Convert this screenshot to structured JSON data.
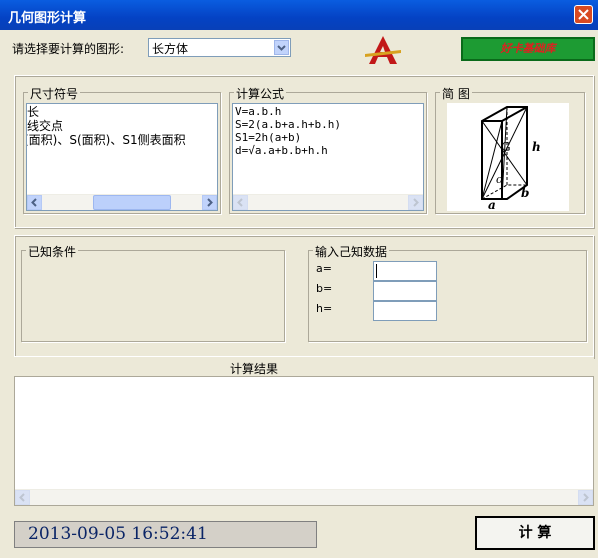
{
  "window": {
    "title": "几何图形计算"
  },
  "shape_select": {
    "label": "请选择要计算的图形:",
    "value": "长方体"
  },
  "green_button": {
    "label": "好卡基础库"
  },
  "dimensions": {
    "legend": "尺寸符号",
    "lines": [
      "长",
      "线交点",
      "(面积)、S(面积)、S1侧表面积"
    ]
  },
  "formulas": {
    "legend": "计算公式",
    "lines": [
      "V=a.b.h",
      "S=2(a.b+a.h+b.h)",
      "S1=2h(a+b)",
      "d=√a.a+b.b+h.h"
    ]
  },
  "diagram": {
    "legend": "简   图",
    "labels": {
      "h": "h",
      "a": "a",
      "b": "b",
      "G": "G",
      "o": "o"
    }
  },
  "known_conditions": {
    "legend": "已知条件"
  },
  "input_data": {
    "legend": "输入己知数据",
    "fields": [
      {
        "label": "a=",
        "value": ""
      },
      {
        "label": "b=",
        "value": ""
      },
      {
        "label": "h=",
        "value": ""
      }
    ]
  },
  "result": {
    "header": "计算结果",
    "value": ""
  },
  "status": {
    "datetime": "2013-09-05  16:52:41"
  },
  "calc_button": {
    "label": "计  算"
  },
  "colors": {
    "titlebar": "#0a5de0",
    "green_button": "#1d9b33",
    "status_text": "#0a2466"
  }
}
